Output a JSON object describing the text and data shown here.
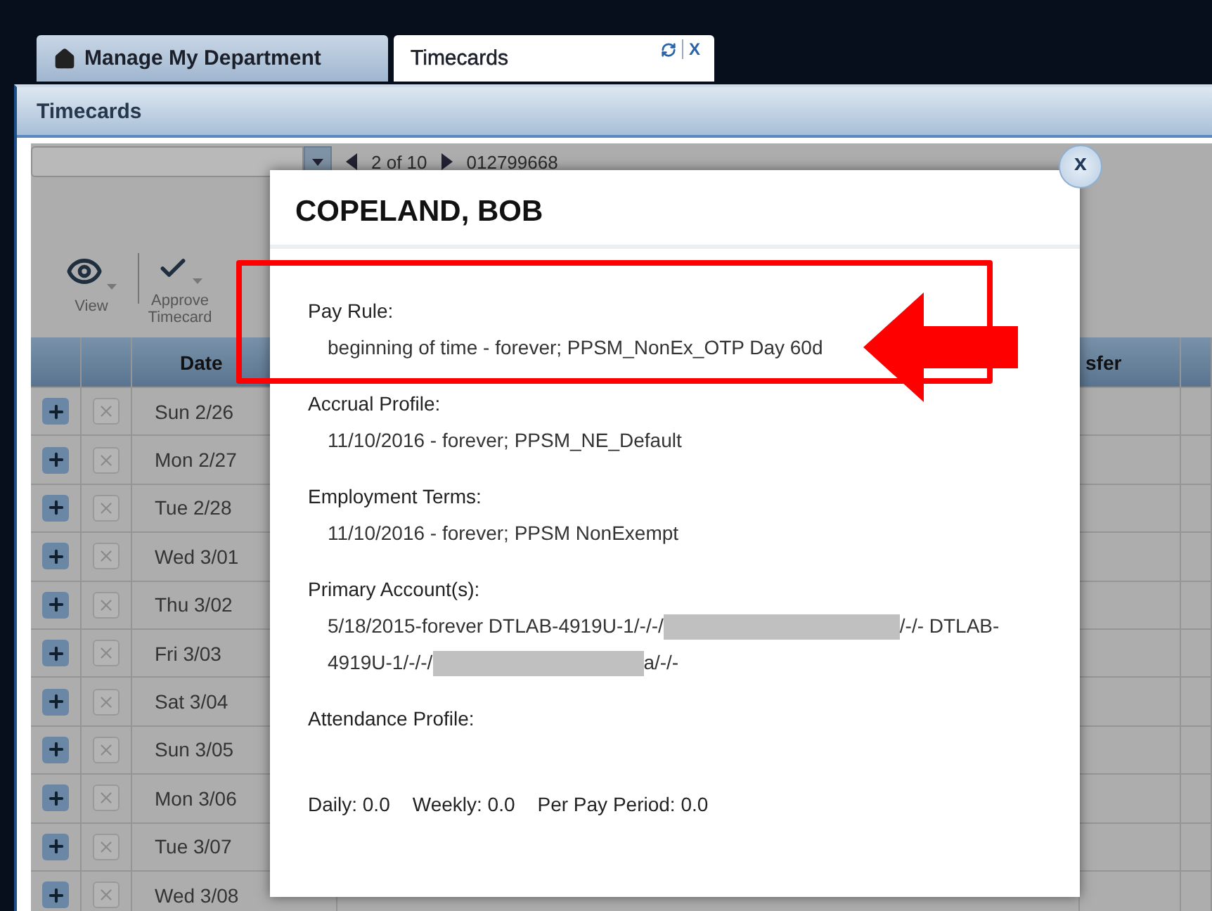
{
  "tabs": [
    {
      "label": "Manage My Department",
      "selected": false
    },
    {
      "label": "Timecards",
      "selected": true,
      "close_label": "X"
    }
  ],
  "panel": {
    "title": "Timecards"
  },
  "navigator": {
    "position": "2 of 10",
    "employee_id": "012799668"
  },
  "toolbar": [
    {
      "label": "View"
    },
    {
      "label": "Approve Timecard"
    }
  ],
  "grid": {
    "date_header": "Date",
    "column_4_header": "sfer",
    "rows": [
      {
        "date": "Sun 2/26"
      },
      {
        "date": "Mon 2/27"
      },
      {
        "date": "Tue 2/28"
      },
      {
        "date": "Wed 3/01"
      },
      {
        "date": "Thu 3/02"
      },
      {
        "date": "Fri 3/03"
      },
      {
        "date": "Sat 3/04"
      },
      {
        "date": "Sun 3/05"
      },
      {
        "date": "Mon 3/06"
      },
      {
        "date": "Tue 3/07"
      },
      {
        "date": "Wed 3/08"
      }
    ]
  },
  "dialog": {
    "title": "COPELAND, BOB",
    "close_label": "x",
    "sections": [
      {
        "label": "Pay Rule:",
        "lines": [
          [
            {
              "kind": "text",
              "text": "beginning of time - forever; PPSM_NonEx_OTP Day 60d"
            }
          ]
        ]
      },
      {
        "label": "Accrual Profile:",
        "lines": [
          [
            {
              "kind": "text",
              "text": "11/10/2016 - forever; PPSM_NE_Default"
            }
          ]
        ]
      },
      {
        "label": "Employment Terms:",
        "lines": [
          [
            {
              "kind": "text",
              "text": "11/10/2016 - forever; PPSM NonExempt"
            }
          ]
        ]
      },
      {
        "label": "Primary Account(s):",
        "lines": [
          [
            {
              "kind": "text",
              "text": "5/18/2015-forever DTLAB-4919U-1/-/-/"
            },
            {
              "kind": "redacted"
            },
            {
              "kind": "text",
              "text": "/-/- DTLAB-"
            }
          ],
          [
            {
              "kind": "text",
              "text": "4919U-1/-/-/"
            },
            {
              "kind": "redacted"
            },
            {
              "kind": "text",
              "text": "a/-/-"
            }
          ]
        ]
      },
      {
        "label": "Attendance Profile:"
      }
    ],
    "totals": [
      "Daily: 0.0",
      "Weekly: 0.0",
      "Per Pay Period: 0.0"
    ]
  }
}
